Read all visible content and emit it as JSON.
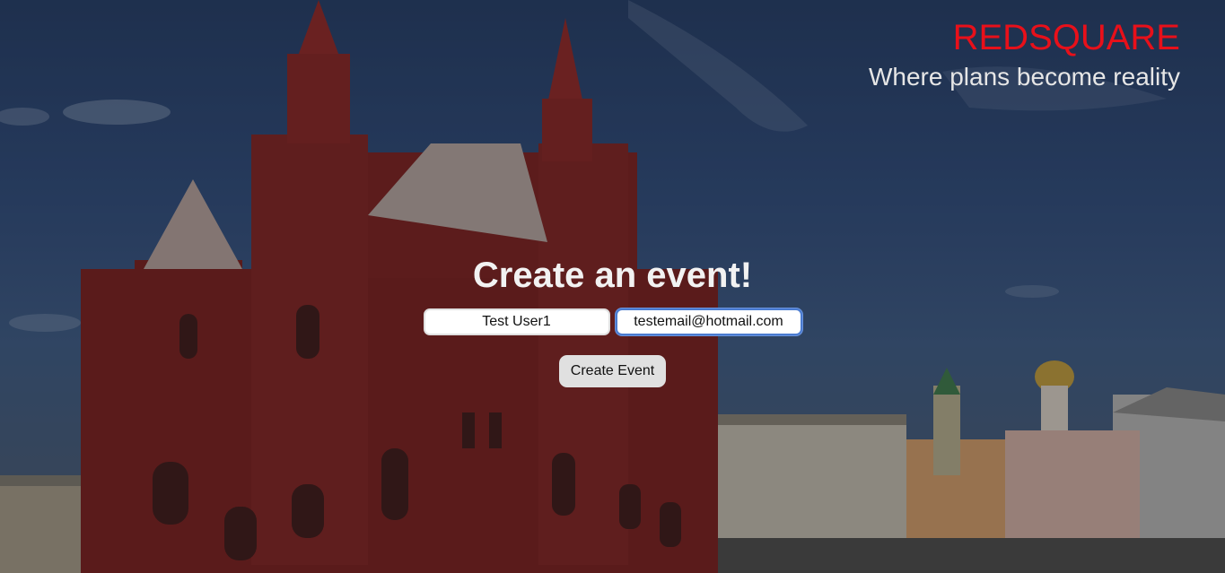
{
  "brand": {
    "title": "REDSQUARE",
    "tagline": "Where plans become reality",
    "title_color": "#e8101a"
  },
  "form": {
    "heading": "Create an event!",
    "name_field": {
      "value": "Test User1"
    },
    "email_field": {
      "value": "testemail@hotmail.com"
    },
    "submit_label": "Create Event"
  },
  "background": {
    "description_icon": "red-square-photo"
  }
}
